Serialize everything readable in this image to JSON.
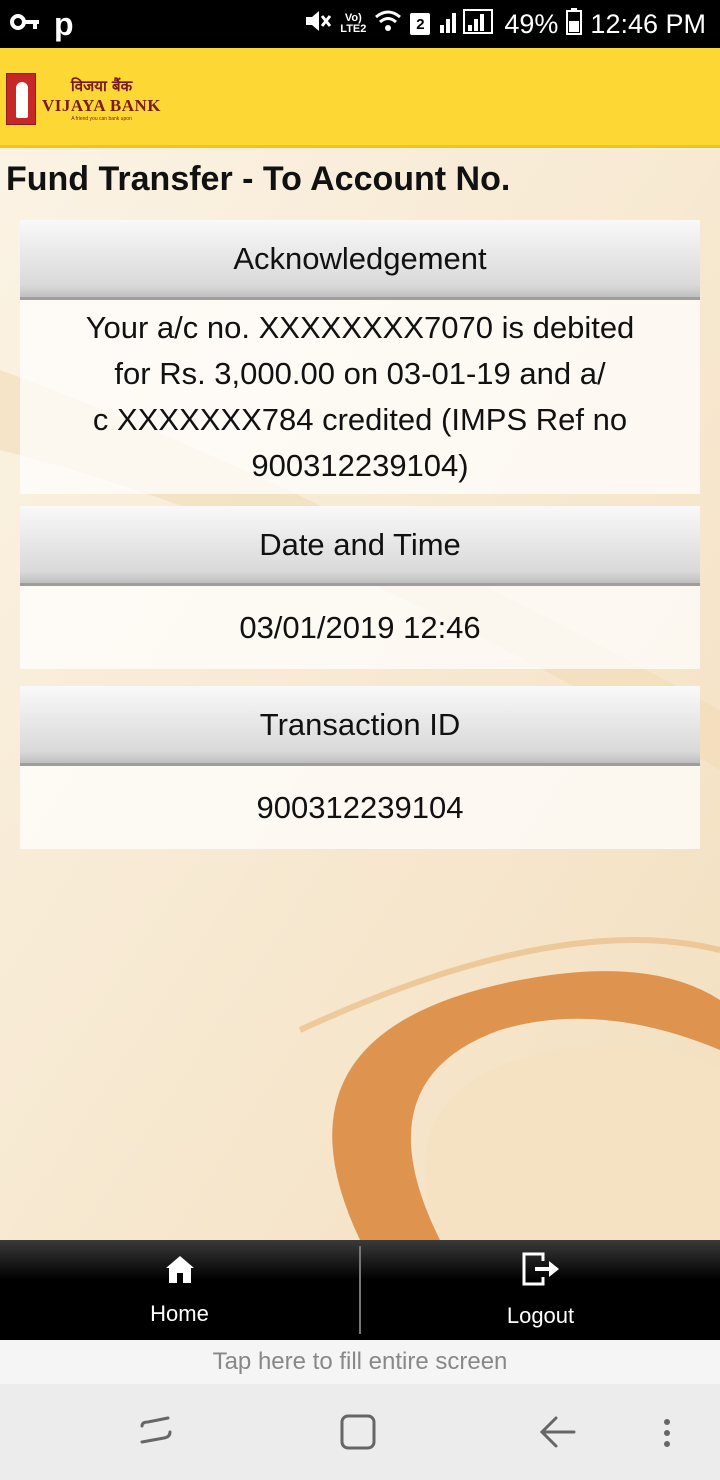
{
  "status_bar": {
    "left_icons": [
      "key-icon",
      "p-icon"
    ],
    "p_label": "p",
    "volte_top": "Vo)",
    "volte_bottom": "LTE2",
    "sim_badge": "2",
    "battery_percent": "49%",
    "time": "12:46 PM"
  },
  "header": {
    "logo_hindi": "विजया बैंक",
    "logo_english": "VIJAYA BANK",
    "logo_tagline": "A friend you can bank upon"
  },
  "page": {
    "title": "Fund Transfer - To Account No."
  },
  "cards": [
    {
      "heading": "Acknowledgement",
      "body_lines": [
        "Your a/c no. XXXXXXXX7070 is debited",
        "for Rs. 3,000.00 on 03-01-19 and a/",
        "c XXXXXXX784 credited (IMPS Ref no",
        "900312239104)"
      ]
    },
    {
      "heading": "Date and Time",
      "value": "03/01/2019 12:46"
    },
    {
      "heading": "Transaction ID",
      "value": "900312239104"
    }
  ],
  "bottom_nav": {
    "home_label": "Home",
    "logout_label": "Logout"
  },
  "fill_screen_text": "Tap here to fill entire screen",
  "colors": {
    "header_yellow": "#fdd835",
    "background_cream": "#f7eedc",
    "swoosh_orange": "#d9863a"
  }
}
